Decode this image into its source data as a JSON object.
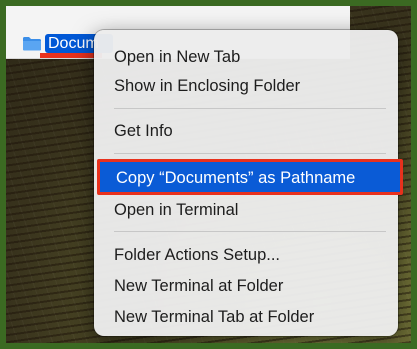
{
  "finder": {
    "selected_folder": {
      "name": "Docum",
      "icon": "folder-icon"
    }
  },
  "context_menu": {
    "items": [
      {
        "label": "Open in New Tab"
      },
      {
        "label": "Show in Enclosing Folder"
      },
      {
        "label": "Get Info"
      },
      {
        "label": "Copy “Documents” as Pathname",
        "highlighted": true
      },
      {
        "label": "Open in Terminal"
      },
      {
        "label": "Folder Actions Setup..."
      },
      {
        "label": "New Terminal at Folder"
      },
      {
        "label": "New Terminal Tab at Folder"
      }
    ]
  },
  "colors": {
    "highlight": "#0a5bd6",
    "annotation_red": "#e8311d",
    "frame_green": "#3b6a22"
  }
}
